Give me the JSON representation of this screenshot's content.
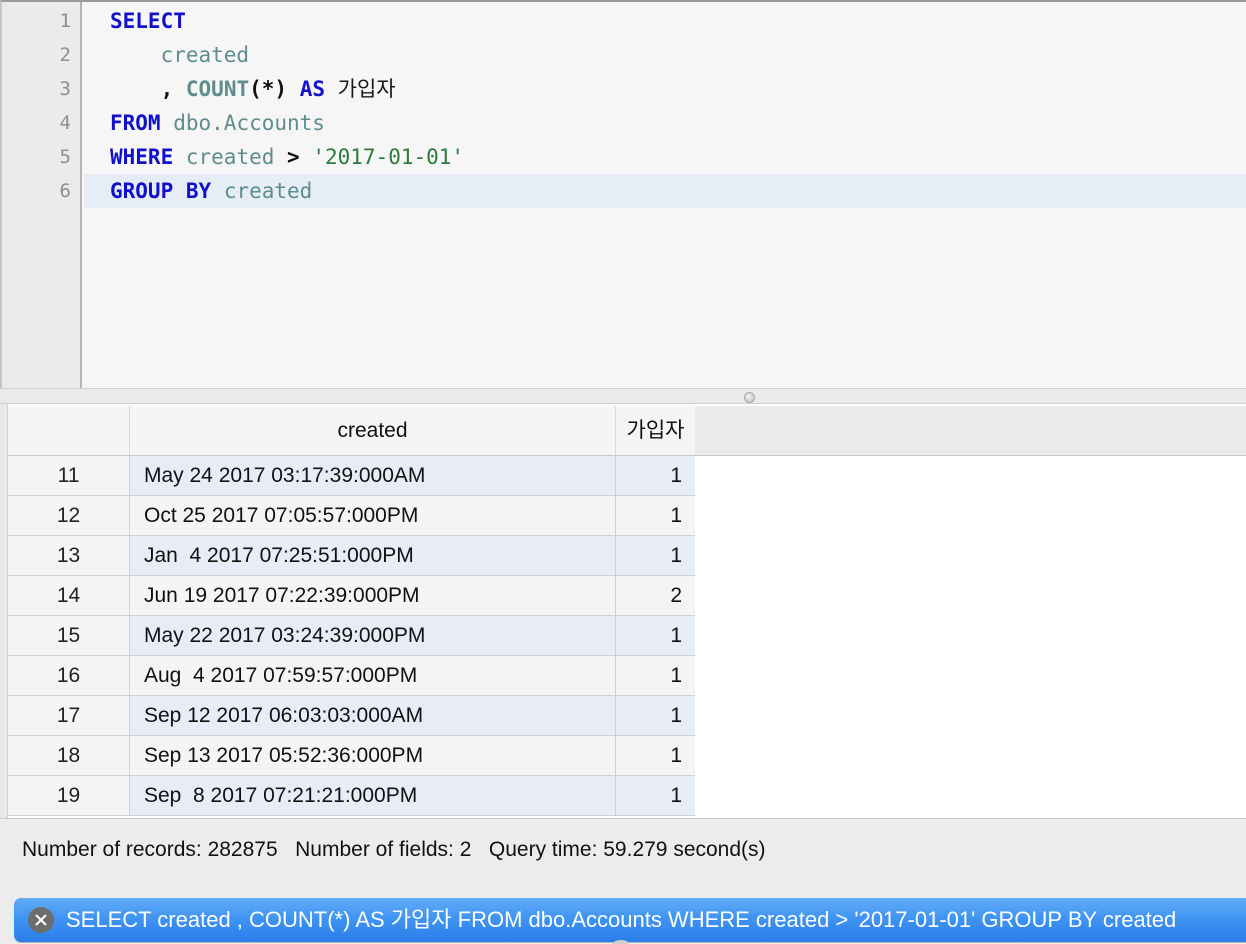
{
  "editor": {
    "line_numbers": [
      "1",
      "2",
      "3",
      "4",
      "5",
      "6"
    ],
    "current_line": 6,
    "lines": [
      {
        "n": 1,
        "plain": "SELECT",
        "tokens": [
          {
            "t": "SELECT",
            "k": "kw"
          }
        ]
      },
      {
        "n": 2,
        "plain": "    created",
        "tokens": [
          {
            "t": "    ",
            "k": "plain"
          },
          {
            "t": "created",
            "k": "id"
          }
        ]
      },
      {
        "n": 3,
        "plain": "    , COUNT(*) AS 가입자",
        "tokens": [
          {
            "t": "    ",
            "k": "plain"
          },
          {
            "t": ",",
            "k": "punct"
          },
          {
            "t": " ",
            "k": "plain"
          },
          {
            "t": "COUNT",
            "k": "fn"
          },
          {
            "t": "(*)",
            "k": "punct"
          },
          {
            "t": " ",
            "k": "plain"
          },
          {
            "t": "AS",
            "k": "kw"
          },
          {
            "t": " ",
            "k": "plain"
          },
          {
            "t": "가입자",
            "k": "plain"
          }
        ]
      },
      {
        "n": 4,
        "plain": "FROM dbo.Accounts",
        "tokens": [
          {
            "t": "FROM",
            "k": "kw"
          },
          {
            "t": " ",
            "k": "plain"
          },
          {
            "t": "dbo.Accounts",
            "k": "id"
          }
        ]
      },
      {
        "n": 5,
        "plain": "WHERE created > '2017-01-01'",
        "tokens": [
          {
            "t": "WHERE",
            "k": "kw"
          },
          {
            "t": " ",
            "k": "plain"
          },
          {
            "t": "created",
            "k": "id"
          },
          {
            "t": " ",
            "k": "plain"
          },
          {
            "t": ">",
            "k": "op"
          },
          {
            "t": " ",
            "k": "plain"
          },
          {
            "t": "'2017-01-01'",
            "k": "str"
          }
        ]
      },
      {
        "n": 6,
        "plain": "GROUP BY created",
        "tokens": [
          {
            "t": "GROUP",
            "k": "kw"
          },
          {
            "t": " ",
            "k": "plain"
          },
          {
            "t": "BY",
            "k": "kw"
          },
          {
            "t": " ",
            "k": "plain"
          },
          {
            "t": "created",
            "k": "id"
          }
        ]
      }
    ]
  },
  "splitter": {
    "grip_icon": "splitter-grip-handle"
  },
  "results": {
    "columns": [
      {
        "key": "rownum",
        "label": ""
      },
      {
        "key": "created",
        "label": "created"
      },
      {
        "key": "count",
        "label": "가입자"
      }
    ],
    "rows": [
      {
        "rownum": "11",
        "created": "May 24 2017 03:17:39:000AM",
        "count": "1"
      },
      {
        "rownum": "12",
        "created": "Oct 25 2017 07:05:57:000PM",
        "count": "1"
      },
      {
        "rownum": "13",
        "created": "Jan  4 2017 07:25:51:000PM",
        "count": "1"
      },
      {
        "rownum": "14",
        "created": "Jun 19 2017 07:22:39:000PM",
        "count": "2"
      },
      {
        "rownum": "15",
        "created": "May 22 2017 03:24:39:000PM",
        "count": "1"
      },
      {
        "rownum": "16",
        "created": "Aug  4 2017 07:59:57:000PM",
        "count": "1"
      },
      {
        "rownum": "17",
        "created": "Sep 12 2017 06:03:03:000AM",
        "count": "1"
      },
      {
        "rownum": "18",
        "created": "Sep 13 2017 05:52:36:000PM",
        "count": "1"
      },
      {
        "rownum": "19",
        "created": "Sep  8 2017 07:21:21:000PM",
        "count": "1"
      }
    ]
  },
  "status": {
    "text": "Number of records: 282875   Number of fields: 2   Query time: 59.279 second(s)",
    "records_label": "Number of records:",
    "records_value": "282875",
    "fields_label": "Number of fields:",
    "fields_value": "2",
    "query_time_label": "Query time:",
    "query_time_value": "59.279 second(s)"
  },
  "bottom_bar": {
    "close_icon": "close-circle-icon",
    "text": "SELECT created , COUNT(*) AS 가입자 FROM dbo.Accounts WHERE created > '2017-01-01' GROUP BY created",
    "accent_color": "#3e93f2"
  }
}
